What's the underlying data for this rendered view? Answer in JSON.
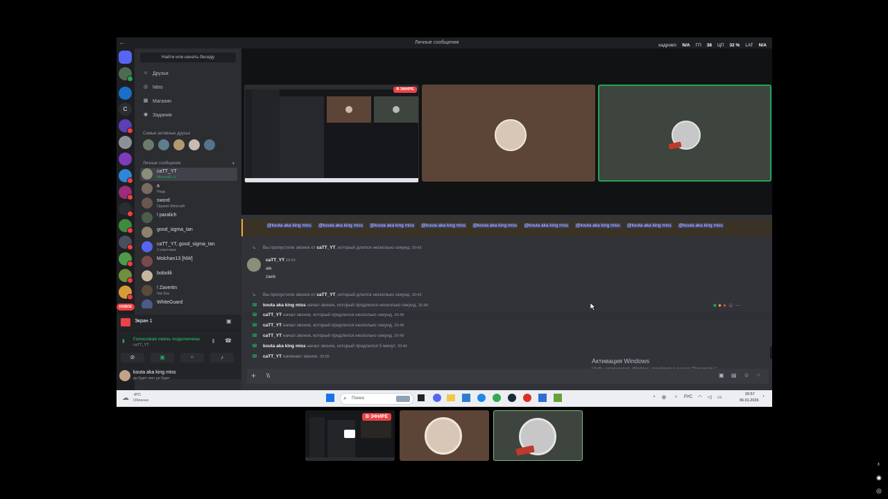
{
  "titlebar": {
    "title": "Личные сообщения",
    "stats": [
      "кадров/с",
      "N/A",
      "ГП",
      "38",
      "ЦП",
      "32 %",
      "LAT",
      "N/A"
    ]
  },
  "sidebar": {
    "search": "Найти или начать беседу",
    "nav": [
      {
        "label": "Друзья",
        "icon": "friends-icon"
      },
      {
        "label": "Nitro",
        "icon": "nitro-icon"
      },
      {
        "label": "Магазин",
        "icon": "shop-icon"
      },
      {
        "label": "Задания",
        "icon": "quests-icon"
      }
    ],
    "active_friends_title": "Самые активные друзья",
    "dm_title": "Личные сообщения",
    "dms": [
      {
        "name": "caTT_YT",
        "sub": "Minecraft +1",
        "active": true
      },
      {
        "name": "a",
        "sub": "Нюдь"
      },
      {
        "name": "sword",
        "sub": "Оружие Minecraft"
      },
      {
        "name": "! paralich",
        "sub": ""
      },
      {
        "name": "good_sigma_tan",
        "sub": ""
      },
      {
        "name": "caTT_YT, good_sigma_tan",
        "sub": "3 участника"
      },
      {
        "name": "Molchan13 [NW]",
        "sub": ""
      },
      {
        "name": "bobolili",
        "sub": ""
      },
      {
        "name": "! Zavertin",
        "sub": "Чек Биз"
      },
      {
        "name": "WhiteGuard",
        "sub": ""
      }
    ],
    "new_badge": "НОВОЕ",
    "screen_label": "Экран 1",
    "voice_connected": "Голосовая связь подключена",
    "voice_channel": "caTT_YT",
    "user_name": "kouta aka king miss",
    "user_status": "да будет свет да будет"
  },
  "stage": {
    "live_badge": "В ЭФИРЕ"
  },
  "chat": {
    "mention_handle": "@kouta aka king miss",
    "messages": [
      {
        "kind": "missed",
        "pre": "Вы пропустили звонок от ",
        "name": "caTT_YT",
        "post": ", который длился несколько секунд.",
        "time": "20:43"
      },
      {
        "kind": "author",
        "name": "caTT_YT",
        "time": "20:43",
        "lines": [
          "ale",
          "zaeb"
        ]
      },
      {
        "kind": "missed",
        "pre": "Вы пропустили звонок от ",
        "name": "caTT_YT",
        "post": ", который длился несколько секунд.",
        "time": "20:43"
      },
      {
        "kind": "call",
        "pre": "",
        "name": "kouta aka king miss",
        "post": " начал звонок, который продлился несколько секунд.",
        "time": "20:48"
      },
      {
        "kind": "call",
        "pre": "",
        "name": "caTT_YT",
        "post": " начал звонок, который продлился несколько секунд.",
        "time": "20:49"
      },
      {
        "kind": "call",
        "pre": "",
        "name": "caTT_YT",
        "post": " начал звонок, который продлился несколько секунд.",
        "time": "20:49"
      },
      {
        "kind": "call",
        "pre": "",
        "name": "caTT_YT",
        "post": " начал звонок, который продлился несколько секунд.",
        "time": "20:49"
      },
      {
        "kind": "call",
        "pre": "",
        "name": "kouta aka king miss",
        "post": " начал звонок, который продлился 5 минут.",
        "time": "20:49"
      },
      {
        "kind": "call",
        "pre": "",
        "name": "caTT_YT",
        "post": " начинает звонок.",
        "time": "20:55"
      }
    ],
    "input_value": "\\\\",
    "activation_title": "Активация Windows",
    "activation_sub": "Чтобы активировать Windows, перейдите в раздел \"Параметры\"."
  },
  "taskbar": {
    "weather_temp": "-8°C",
    "weather_desc": "Облачно",
    "search_placeholder": "Поиск",
    "lang": "РУС",
    "time": "20:57",
    "date": "06.01.2026"
  },
  "thumbs": {
    "live_badge": "В ЭФИРЕ"
  },
  "colors": {
    "accent": "#5865f2",
    "live": "#ed4245",
    "speaking": "#23a55a"
  }
}
